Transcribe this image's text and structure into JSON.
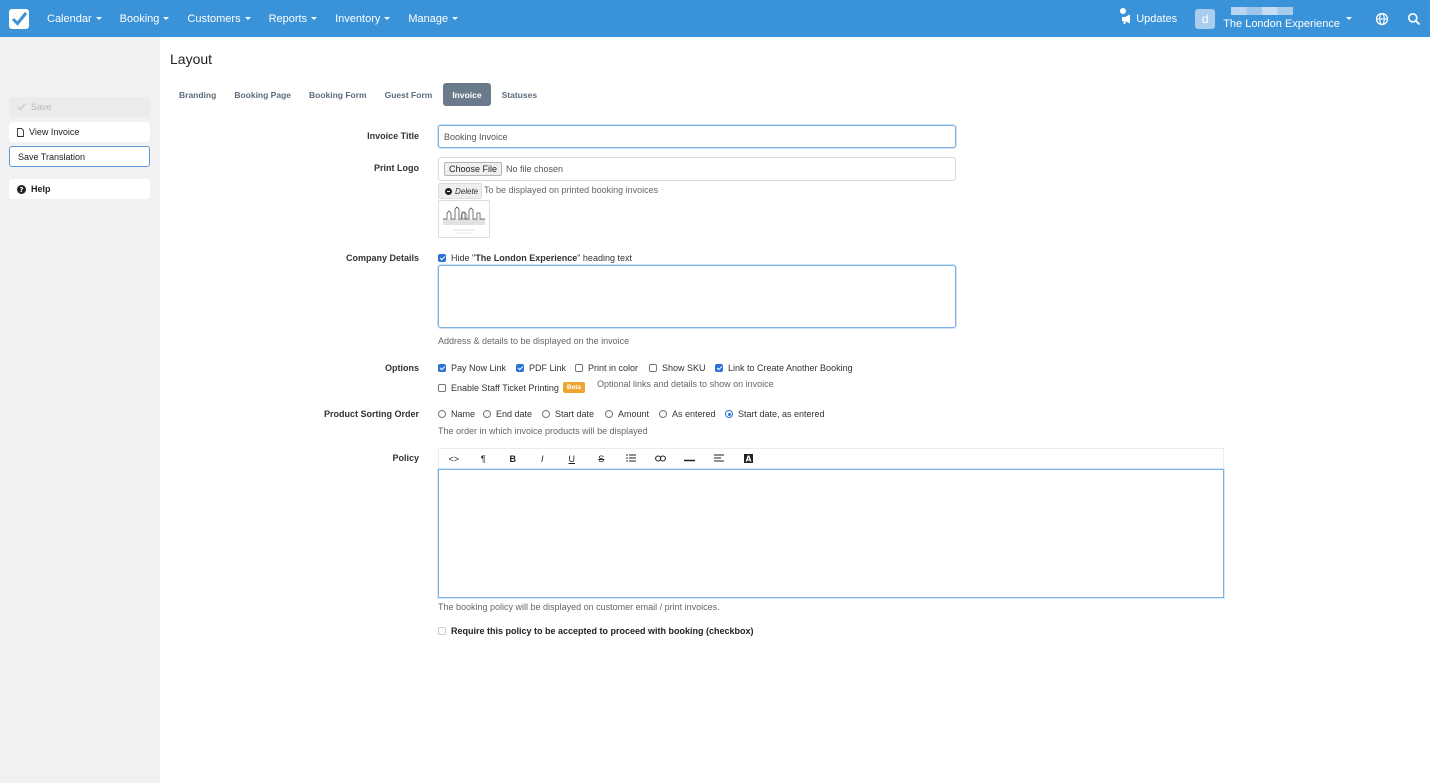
{
  "nav": {
    "items": [
      "Calendar",
      "Booking",
      "Customers",
      "Reports",
      "Inventory",
      "Manage"
    ],
    "updates": "Updates",
    "avatar_letter": "d",
    "account_name": "The London Experience",
    "brand_color": "#3a92d8"
  },
  "sidebar": {
    "save": "Save",
    "view_invoice": "View Invoice",
    "save_translation": "Save Translation",
    "help": "Help"
  },
  "page": {
    "title": "Layout",
    "tabs": [
      "Branding",
      "Booking Page",
      "Booking Form",
      "Guest Form",
      "Invoice",
      "Statuses"
    ],
    "active_tab": "Invoice"
  },
  "form": {
    "invoice_title_label": "Invoice Title",
    "invoice_title_value": "Booking Invoice",
    "print_logo_label": "Print Logo",
    "choose_file": "Choose File",
    "no_file": "No file chosen",
    "delete": "Delete",
    "logo_help": "To be displayed on printed booking invoices",
    "company_details_label": "Company Details",
    "hide_prefix": "Hide \"",
    "hide_company": "The London Experience",
    "hide_suffix": "\" heading text",
    "company_help": "Address & details to be displayed on the invoice",
    "options_label": "Options",
    "options": [
      {
        "label": "Pay Now Link",
        "checked": true
      },
      {
        "label": "PDF Link",
        "checked": true
      },
      {
        "label": "Print in color",
        "checked": false
      },
      {
        "label": "Show SKU",
        "checked": false
      },
      {
        "label": "Link to Create Another Booking",
        "checked": true
      },
      {
        "label": "Enable Staff Ticket Printing",
        "checked": false
      }
    ],
    "beta": "Beta",
    "options_help": "Optional links and details to show on invoice",
    "sorting_label": "Product Sorting Order",
    "sorting": [
      "Name",
      "End date",
      "Start date",
      "Amount",
      "As entered",
      "Start date, as entered"
    ],
    "sorting_selected": "Start date, as entered",
    "sorting_help": "The order in which invoice products will be displayed",
    "policy_label": "Policy",
    "policy_help": "The booking policy will be displayed on customer email / print invoices.",
    "require_policy": "Require this policy to be accepted to proceed with booking (checkbox)"
  }
}
